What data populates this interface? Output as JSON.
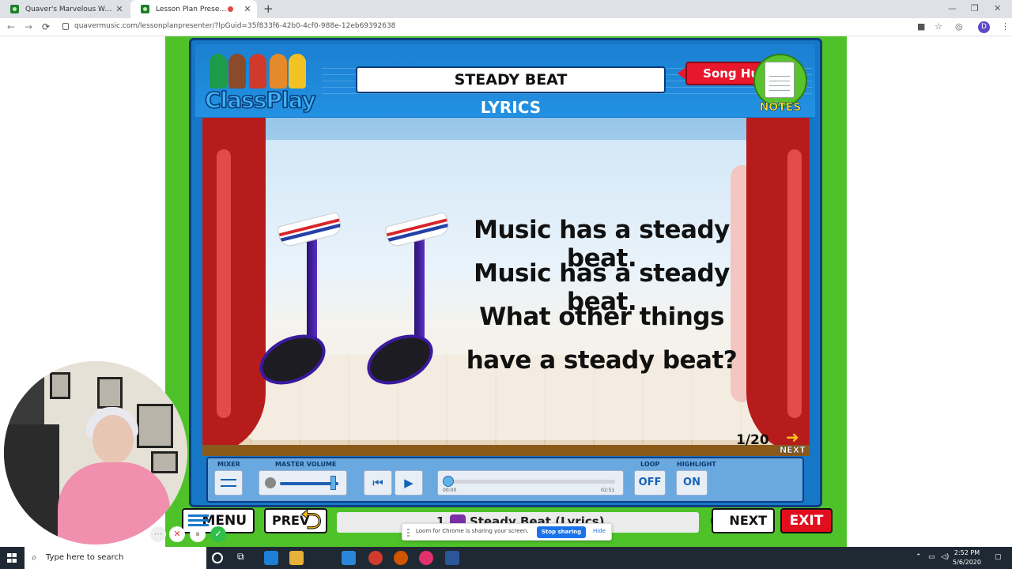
{
  "browser": {
    "tabs": [
      {
        "title": "Quaver's Marvelous World Of Mu",
        "close": "✕"
      },
      {
        "title": "Lesson Plan Presenter",
        "close": "✕"
      }
    ],
    "new_tab": "+",
    "window_controls": {
      "minimize": "—",
      "restore": "❐",
      "close": "✕"
    },
    "nav": {
      "back": "←",
      "forward": "→",
      "reload": "⟳"
    },
    "url": "quavermusic.com/lessonplanpresenter/?lpGuid=35f833f6-42b0-4cf0-988e-12eb69392638",
    "profile_initial": "D"
  },
  "app": {
    "logo_text": "ClassPlay",
    "title": "STEADY BEAT",
    "subtitle": "LYRICS",
    "song_hub_label": "Song Hub",
    "notes_label": "NOTES",
    "lyrics": [
      "Music has a steady beat.",
      "Music has a steady beat.",
      "What other things",
      "have a steady beat?"
    ],
    "page_counter": "1/20",
    "next_small_label": "NEXT",
    "player": {
      "mixer_label": "MIXER",
      "master_volume_label": "MASTER VOLUME",
      "loop_label": "LOOP",
      "highlight_label": "HIGHLIGHT",
      "loop_value": "OFF",
      "highlight_value": "ON",
      "current_time": "00:00",
      "total_time": "02:51",
      "volume_level": 0.9,
      "progress": 0.0
    },
    "bottom_nav": {
      "menu_label": "MENU",
      "prev_label": "PREV",
      "track_number": "1.",
      "track_title": "Steady Beat (Lyrics)",
      "next_label": "NEXT",
      "exit_label": "EXIT"
    }
  },
  "loom": {
    "message": "Loom for Chrome is sharing your screen.",
    "stop_label": "Stop sharing",
    "hide_label": "Hide"
  },
  "taskbar": {
    "search_placeholder": "Type here to search",
    "time": "2:52 PM",
    "date": "5/6/2020"
  },
  "colors": {
    "page_green": "#4fc22a",
    "frame_blue": "#1777c7",
    "exit_red": "#e10f1d",
    "song_hub_red": "#e8172c",
    "accent_yellow": "#f7b917"
  }
}
